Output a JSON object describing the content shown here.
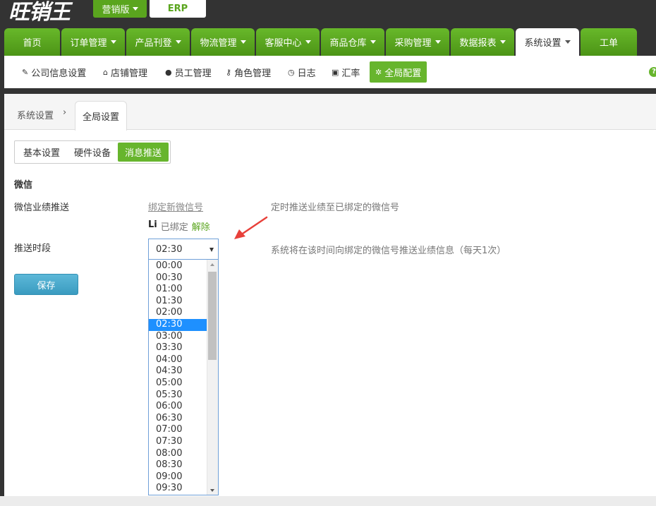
{
  "header": {
    "logo_text": "旺销王",
    "edition_label": "营销版",
    "erp_label": "ERP"
  },
  "main_nav": [
    {
      "label": "首页",
      "has_menu": false,
      "active": false
    },
    {
      "label": "订单管理",
      "has_menu": true,
      "active": false
    },
    {
      "label": "产品刊登",
      "has_menu": true,
      "active": false
    },
    {
      "label": "物流管理",
      "has_menu": true,
      "active": false
    },
    {
      "label": "客服中心",
      "has_menu": true,
      "active": false
    },
    {
      "label": "商品仓库",
      "has_menu": true,
      "active": false
    },
    {
      "label": "采购管理",
      "has_menu": true,
      "active": false
    },
    {
      "label": "数据报表",
      "has_menu": true,
      "active": false
    },
    {
      "label": "系统设置",
      "has_menu": true,
      "active": true
    },
    {
      "label": "工单",
      "has_menu": false,
      "active": false
    }
  ],
  "sub_nav": [
    {
      "icon": "edit-icon",
      "label": "公司信息设置",
      "active": false
    },
    {
      "icon": "home-icon",
      "label": "店铺管理",
      "active": false
    },
    {
      "icon": "user-icon",
      "label": "员工管理",
      "active": false
    },
    {
      "icon": "key-icon",
      "label": "角色管理",
      "active": false
    },
    {
      "icon": "clock-icon",
      "label": "日志",
      "active": false
    },
    {
      "icon": "money-icon",
      "label": "汇率",
      "active": false
    },
    {
      "icon": "gear-icon",
      "label": "全局配置",
      "active": true
    }
  ],
  "breadcrumb": {
    "parent": "系统设置",
    "separator": "›",
    "current_tab": "全局设置"
  },
  "settings_tabs": [
    {
      "label": "基本设置",
      "active": false
    },
    {
      "label": "硬件设备",
      "active": false
    },
    {
      "label": "消息推送",
      "active": true
    }
  ],
  "wechat": {
    "section_title": "微信",
    "push_label": "微信业绩推送",
    "bind_link": "绑定新微信号",
    "push_desc": "定时推送业绩至已绑定的微信号",
    "bound_nick": "Li",
    "bound_status": "已绑定",
    "unbind_label": "解除",
    "period_label": "推送时段",
    "period_desc": "系统将在该时间向绑定的微信号推送业绩信息（每天1次）",
    "selected_time": "02:30",
    "time_options": [
      "00:00",
      "00:30",
      "01:00",
      "01:30",
      "02:00",
      "02:30",
      "03:00",
      "03:30",
      "04:00",
      "04:30",
      "05:00",
      "05:30",
      "06:00",
      "06:30",
      "07:00",
      "07:30",
      "08:00",
      "08:30",
      "09:00",
      "09:30"
    ]
  },
  "save_label": "保存",
  "colors": {
    "brand_green": "#5aa51e",
    "accent_blue": "#3a9bc0",
    "selection_blue": "#1e90ff",
    "annotation_red": "#e8403a"
  }
}
